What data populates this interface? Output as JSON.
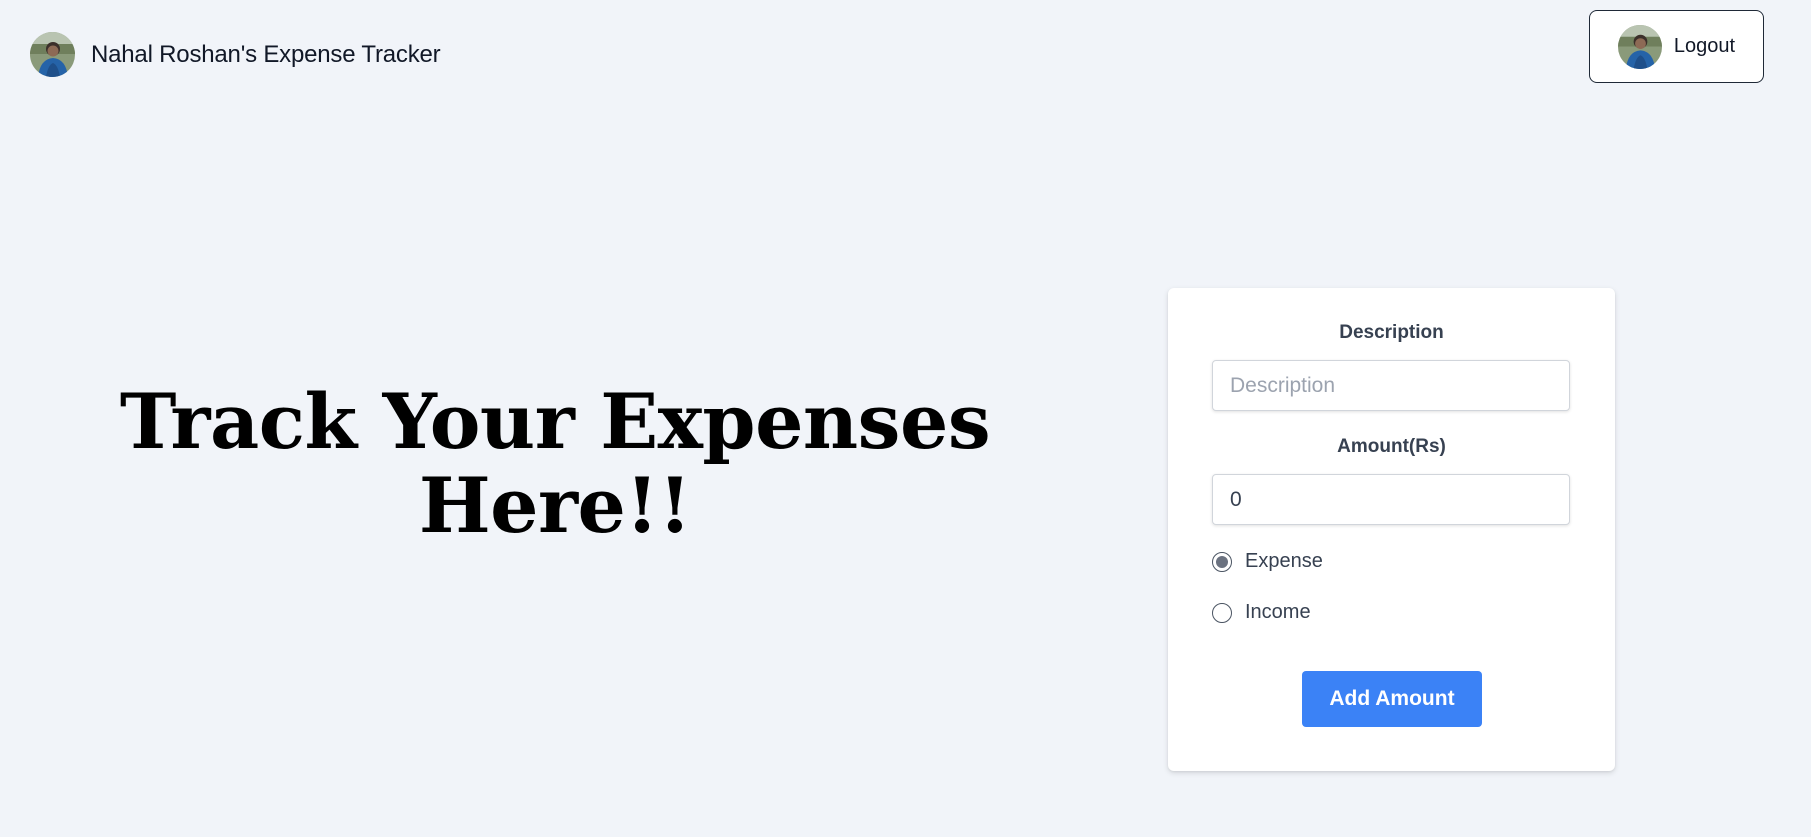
{
  "header": {
    "title": "Nahal Roshan's Expense Tracker",
    "avatar_icon": "user-avatar",
    "logout_label": "Logout"
  },
  "hero": {
    "line1": "Track Your Expenses",
    "line2": "Here!!"
  },
  "form": {
    "description_label": "Description",
    "description_placeholder": "Description",
    "description_value": "",
    "amount_label": "Amount(Rs)",
    "amount_value": "0",
    "type_options": [
      {
        "label": "Expense",
        "selected": true
      },
      {
        "label": "Income",
        "selected": false
      }
    ],
    "submit_label": "Add Amount"
  },
  "colors": {
    "background": "#f1f4f9",
    "primary": "#3b82f6",
    "card": "#ffffff"
  }
}
